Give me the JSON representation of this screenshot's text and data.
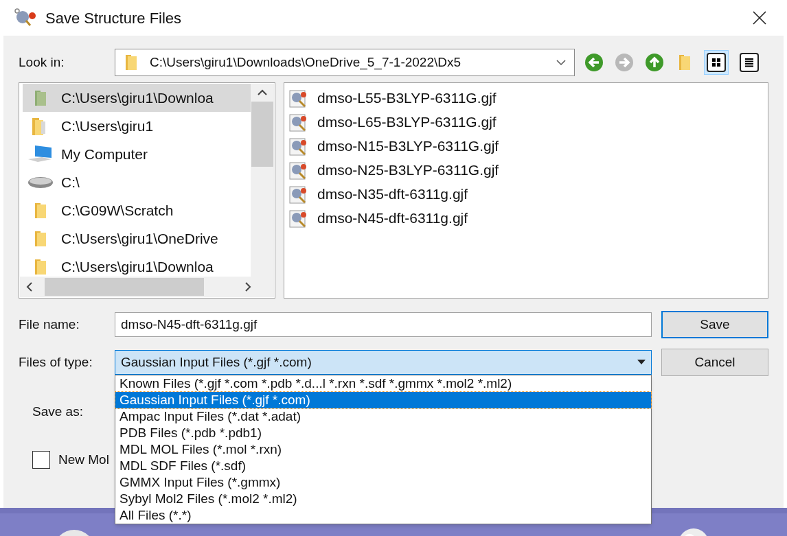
{
  "window": {
    "title": "Save Structure Files"
  },
  "look_in": {
    "label": "Look in:",
    "path": "C:\\Users\\giru1\\Downloads\\OneDrive_5_7-1-2022\\Dx5"
  },
  "nav_buttons": [
    {
      "kind": "back",
      "disabled": false
    },
    {
      "kind": "forward",
      "disabled": true
    },
    {
      "kind": "up",
      "disabled": false
    },
    {
      "kind": "new-folder",
      "disabled": false
    }
  ],
  "view_buttons": [
    {
      "kind": "icons",
      "selected": true
    },
    {
      "kind": "details",
      "selected": false
    }
  ],
  "sidebar": {
    "items": [
      {
        "label": "C:\\Users\\giru1\\Downloa",
        "kind": "folder-green",
        "selected": true
      },
      {
        "label": "C:\\Users\\giru1",
        "kind": "user-folder",
        "selected": false
      },
      {
        "label": "My Computer",
        "kind": "computer",
        "selected": false
      },
      {
        "label": "C:\\",
        "kind": "drive",
        "selected": false
      },
      {
        "label": "C:\\G09W\\Scratch",
        "kind": "folder",
        "selected": false
      },
      {
        "label": "C:\\Users\\giru1\\OneDrive",
        "kind": "folder",
        "selected": false
      },
      {
        "label": "C:\\Users\\giru1\\Downloa",
        "kind": "folder",
        "selected": false
      }
    ]
  },
  "files": [
    {
      "name": "dmso-L55-B3LYP-6311G.gjf"
    },
    {
      "name": "dmso-L65-B3LYP-6311G.gjf"
    },
    {
      "name": "dmso-N15-B3LYP-6311G.gjf"
    },
    {
      "name": "dmso-N25-B3LYP-6311G.gjf"
    },
    {
      "name": "dmso-N35-dft-6311g.gjf"
    },
    {
      "name": "dmso-N45-dft-6311g.gjf"
    }
  ],
  "file_name": {
    "label": "File name:",
    "value": "dmso-N45-dft-6311g.gjf"
  },
  "file_type": {
    "label": "Files of type:",
    "value": "Gaussian Input Files (*.gjf *.com)",
    "options": [
      {
        "label": "Known Files (*.gjf *.com *.pdb *.d...l *.rxn *.sdf *.gmmx *.mol2 *.ml2)",
        "selected": false
      },
      {
        "label": "Gaussian Input Files (*.gjf *.com)",
        "selected": true
      },
      {
        "label": "Ampac Input Files (*.dat *.adat)",
        "selected": false
      },
      {
        "label": "PDB Files (*.pdb *.pdb1)",
        "selected": false
      },
      {
        "label": "MDL MOL Files (*.mol *.rxn)",
        "selected": false
      },
      {
        "label": "MDL SDF Files (*.sdf)",
        "selected": false
      },
      {
        "label": "GMMX Input Files (*.gmmx)",
        "selected": false
      },
      {
        "label": "Sybyl Mol2 Files (*.mol2 *.ml2)",
        "selected": false
      },
      {
        "label": "All Files (*.*)",
        "selected": false
      }
    ]
  },
  "save_as": {
    "label": "Save as:"
  },
  "new_molecule": {
    "label": "New Mol",
    "checked": false
  },
  "buttons": [
    {
      "label": "Save",
      "default": true
    },
    {
      "label": "Cancel",
      "default": false
    }
  ]
}
